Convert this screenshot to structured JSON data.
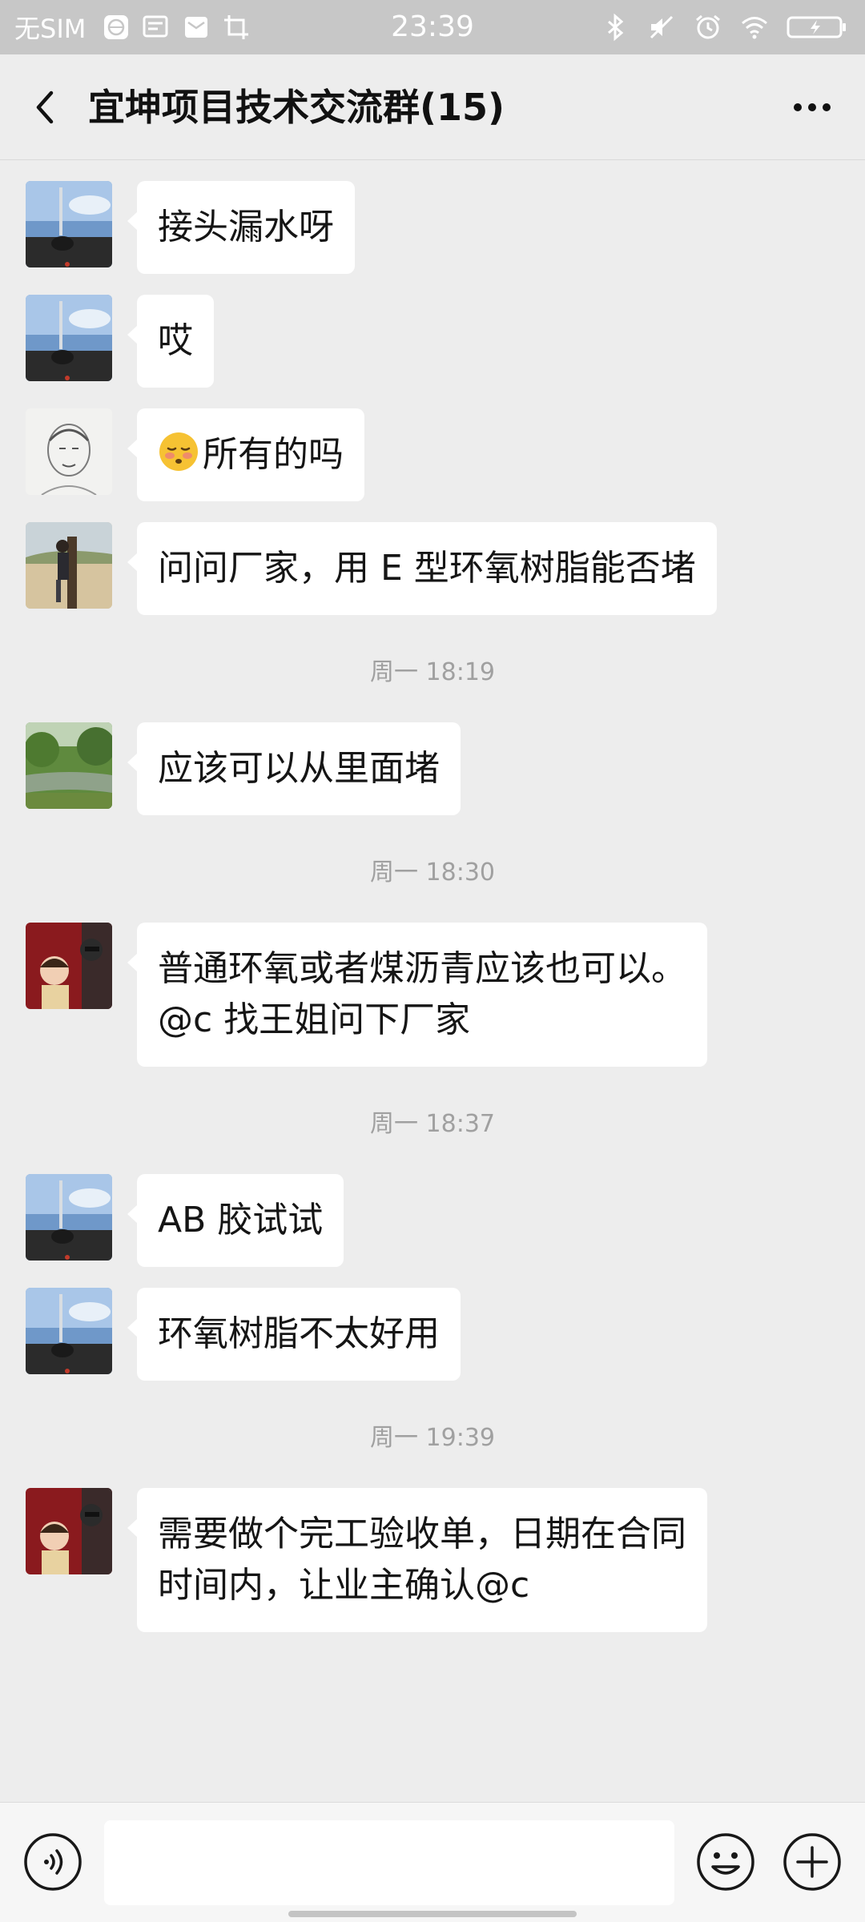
{
  "status_bar": {
    "carrier": "无SIM",
    "time": "23:39",
    "icons_left": [
      "globe-icon",
      "message-icon",
      "mail-icon",
      "screenshot-icon"
    ],
    "icons_right": [
      "bluetooth-icon",
      "mute-icon",
      "alarm-icon",
      "wifi-icon",
      "battery-charging-icon"
    ]
  },
  "header": {
    "back_icon": "chevron-left-icon",
    "title": "宜坤项目技术交流群(15)",
    "more_icon": "more-dots-icon"
  },
  "messages": [
    {
      "avatar": "avatar-sky",
      "text": "接头漏水呀"
    },
    {
      "avatar": "avatar-sky",
      "text": "哎"
    },
    {
      "avatar": "avatar-sketch",
      "emoji": "flushed-face-emoji",
      "text": "所有的吗"
    },
    {
      "avatar": "avatar-tree",
      "text": "问问厂家，用 E 型环氧树脂能否堵"
    },
    {
      "timestamp": "周一 18:19"
    },
    {
      "avatar": "avatar-river",
      "text": "应该可以从里面堵"
    },
    {
      "timestamp": "周一 18:30"
    },
    {
      "avatar": "avatar-kid",
      "lines": [
        "普通环氧或者煤沥青应该也可以。",
        "@c  找王姐问下厂家"
      ]
    },
    {
      "timestamp": "周一 18:37"
    },
    {
      "avatar": "avatar-sky",
      "text": "AB 胶试试"
    },
    {
      "avatar": "avatar-sky",
      "text": "环氧树脂不太好用"
    },
    {
      "timestamp": "周一 19:39"
    },
    {
      "avatar": "avatar-kid",
      "lines": [
        "需要做个完工验收单，日期在合同",
        "时间内，让业主确认@c"
      ]
    }
  ],
  "input_bar": {
    "voice_icon": "voice-icon",
    "text_value": "",
    "emoji_icon": "emoji-icon",
    "plus_icon": "plus-icon"
  },
  "colors": {
    "status_bar_bg": "#c7c7c7",
    "chat_bg": "#ededed",
    "bubble_bg": "#ffffff",
    "timestamp_text": "#a0a0a0"
  }
}
